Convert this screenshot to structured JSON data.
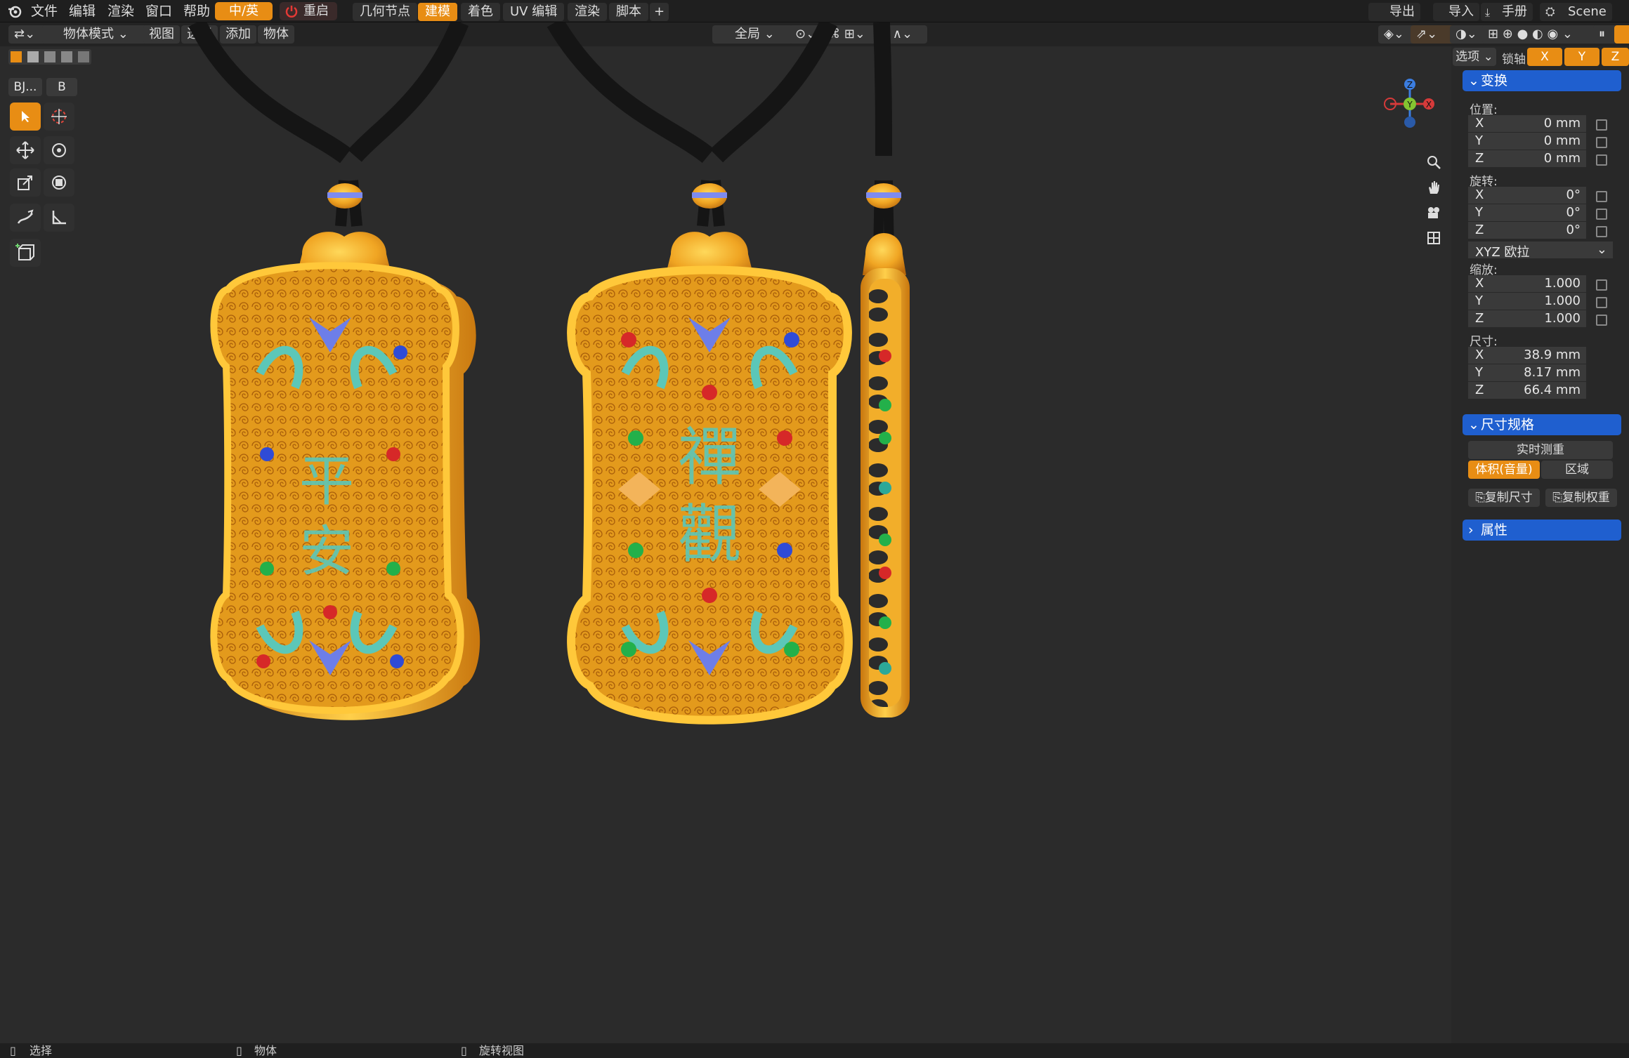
{
  "menubar": {
    "items": [
      "文件",
      "编辑",
      "渲染",
      "窗口",
      "帮助"
    ],
    "lang_toggle": "中/英",
    "restart": "重启",
    "workspaces": [
      "几何节点",
      "建模",
      "着色",
      "UV 编辑",
      "渲染",
      "脚本"
    ],
    "active_workspace": "建模",
    "add_tab": "+",
    "export": "导出",
    "import": "导入",
    "manual": "手册",
    "scene": "Scene"
  },
  "header": {
    "mode": "物体模式",
    "menus": [
      "视图",
      "选择",
      "添加",
      "物体"
    ],
    "orientation": "全局",
    "options": "选项",
    "lock_axis": "锁轴",
    "axes": [
      "X",
      "Y",
      "Z"
    ]
  },
  "toolbar": {
    "bj_label": "BJ...",
    "b_label": "B"
  },
  "npanel": {
    "transform": {
      "title": "变换",
      "location_label": "位置:",
      "location": [
        {
          "axis": "X",
          "value": "0 mm"
        },
        {
          "axis": "Y",
          "value": "0 mm"
        },
        {
          "axis": "Z",
          "value": "0 mm"
        }
      ],
      "rotation_label": "旋转:",
      "rotation": [
        {
          "axis": "X",
          "value": "0°"
        },
        {
          "axis": "Y",
          "value": "0°"
        },
        {
          "axis": "Z",
          "value": "0°"
        }
      ],
      "rotation_mode": "XYZ 欧拉",
      "scale_label": "缩放:",
      "scale": [
        {
          "axis": "X",
          "value": "1.000"
        },
        {
          "axis": "Y",
          "value": "1.000"
        },
        {
          "axis": "Z",
          "value": "1.000"
        }
      ],
      "dimensions_label": "尺寸:",
      "dimensions": [
        {
          "axis": "X",
          "value": "38.9 mm"
        },
        {
          "axis": "Y",
          "value": "8.17 mm"
        },
        {
          "axis": "Z",
          "value": "66.4 mm"
        }
      ]
    },
    "size_spec": {
      "title": "尺寸规格",
      "realtime_weight": "实时测重",
      "volume": "体积(音量)",
      "area": "区域",
      "copy_size": "复制尺寸",
      "copy_weight": "复制权重"
    },
    "properties": {
      "title": "属性"
    }
  },
  "statusbar": {
    "select": "选择",
    "object": "物体",
    "rotate_view": "旋转视图"
  },
  "colors": {
    "accent": "#e88d14",
    "panel_header": "#1f5fcf",
    "gold": "#e0a21f",
    "turquoise": "#5cc7b8"
  }
}
